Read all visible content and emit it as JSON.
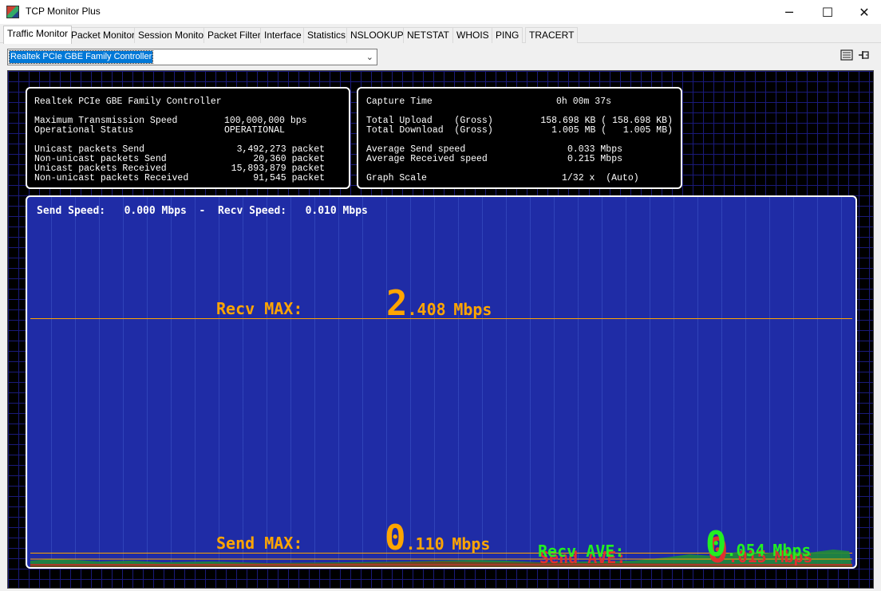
{
  "window": {
    "title": "TCP Monitor Plus",
    "minimize": "─",
    "maximize": "☐",
    "close": "✕"
  },
  "tabs": [
    {
      "label": "Traffic Monitor"
    },
    {
      "label": "Packet Monitor"
    },
    {
      "label": "Session Monitor"
    },
    {
      "label": "Packet Filter"
    },
    {
      "label": "Interface"
    },
    {
      "label": "Statistics"
    },
    {
      "label": "NSLOOKUP"
    },
    {
      "label": "NETSTAT"
    },
    {
      "label": "WHOIS"
    },
    {
      "label": "PING"
    },
    {
      "label": "TRACERT"
    }
  ],
  "adapter": {
    "selected": "Realtek PCIe GBE Family Controller"
  },
  "toolbar": {
    "icons": [
      "list-icon",
      "pin-icon"
    ]
  },
  "interface_panel": {
    "name": "Realtek PCIe GBE Family Controller",
    "max_speed_label": "Maximum Transmission Speed",
    "max_speed_value": "100,000,000 bps",
    "status_label": "Operational Status",
    "status_value": "OPERATIONAL",
    "rows": [
      {
        "label": "Unicast packets Send",
        "value": "3,492,273 packet"
      },
      {
        "label": "Non-unicast packets Send",
        "value": "20,360 packet"
      },
      {
        "label": "Unicast packets Received",
        "value": "15,893,879 packet"
      },
      {
        "label": "Non-unicast packets Received",
        "value": "91,545 packet"
      }
    ]
  },
  "capture_panel": {
    "capture_time_label": "Capture Time",
    "capture_time_value": "0h 00m 37s",
    "upload_label": "Total Upload    (Gross)",
    "upload_value": "158.698 KB ( 158.698 KB)",
    "download_label": "Total Download  (Gross)",
    "download_value": "1.005 MB (   1.005 MB)",
    "avg_send_label": "Average Send speed",
    "avg_send_value": "0.033 Mbps",
    "avg_recv_label": "Average Received speed",
    "avg_recv_value": "0.215 Mbps",
    "scale_label": "Graph Scale",
    "scale_value": "1/32 x  (Auto)"
  },
  "graph": {
    "send_speed_label": "Send Speed:",
    "send_speed_value": "0.000 Mbps",
    "separator": "-",
    "recv_speed_label": "Recv Speed:",
    "recv_speed_value": "0.010 Mbps",
    "recv_max_label": "Recv MAX:",
    "recv_max_int": "2",
    "recv_max_frac": ".408",
    "recv_max_unit": "Mbps",
    "send_max_label": "Send MAX:",
    "send_max_int": "0",
    "send_max_frac": ".110",
    "send_max_unit": "Mbps",
    "recv_ave_label": "Recv AVE:",
    "recv_ave_int": "0",
    "recv_ave_frac": ".054",
    "recv_ave_unit": "Mbps",
    "send_ave_label": "Send AVE:",
    "send_ave_int": "0",
    "send_ave_frac": ".015",
    "send_ave_unit": "Mbps",
    "colors": {
      "max": "#ffa500",
      "recv_ave": "#22ee22",
      "send_ave": "#e03030",
      "background": "#1f2ca6"
    }
  }
}
